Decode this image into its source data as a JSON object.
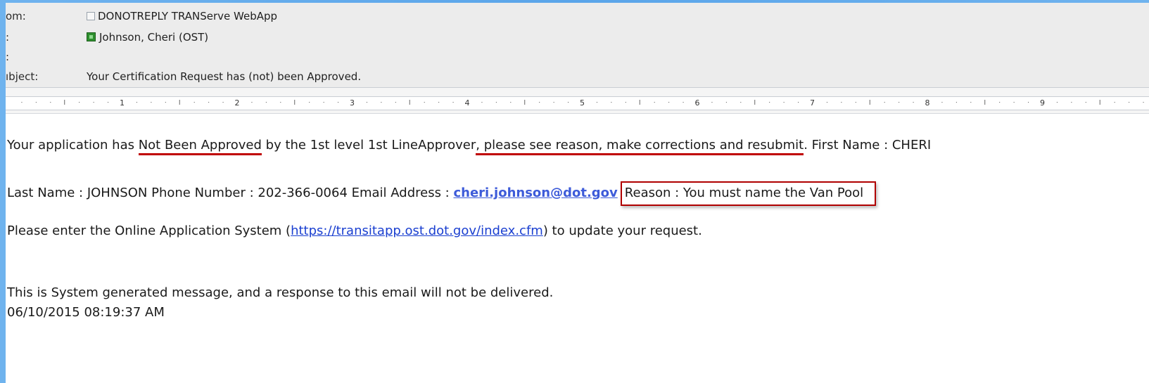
{
  "header": {
    "from_label": "om:",
    "from_value": "DONOTREPLY TRANServe WebApp",
    "to_label": ":",
    "to_value": "Johnson, Cheri (OST)",
    "cc_label": ":",
    "cc_value": "",
    "subject_label": "ıbject:",
    "subject_value": "Your Certification Request has (not) been Approved."
  },
  "ruler": {
    "numbers": [
      "1",
      "2",
      "3",
      "4",
      "5",
      "6",
      "7",
      "8",
      "9"
    ]
  },
  "message": {
    "line1_a": "Your application has ",
    "line1_b": "Not Been Approved",
    "line1_c": " by the 1st level 1st LineApprover",
    "line1_d": ", please see reason, make corrections and resubmit",
    "line1_e": ". First Name : CHERI",
    "line2_a": "Last Name  : JOHNSON Phone Number : 202-366-0064 Email Address  : ",
    "line2_email": "cheri.johnson@dot.gov",
    "line2_reason": "Reason : You must name the Van Pool",
    "line3_a": "Please enter the Online Application System (",
    "line3_url": "https://transitapp.ost.dot.gov/index.cfm",
    "line3_b": ") to update your request.",
    "line4": "This is System generated message, and a response to this email will not be delivered.",
    "line5": "06/10/2015 08:19:37 AM"
  },
  "colors": {
    "annotation_red": "#c00000",
    "link_blue": "#1a3fd0",
    "header_bg": "#ececec"
  }
}
